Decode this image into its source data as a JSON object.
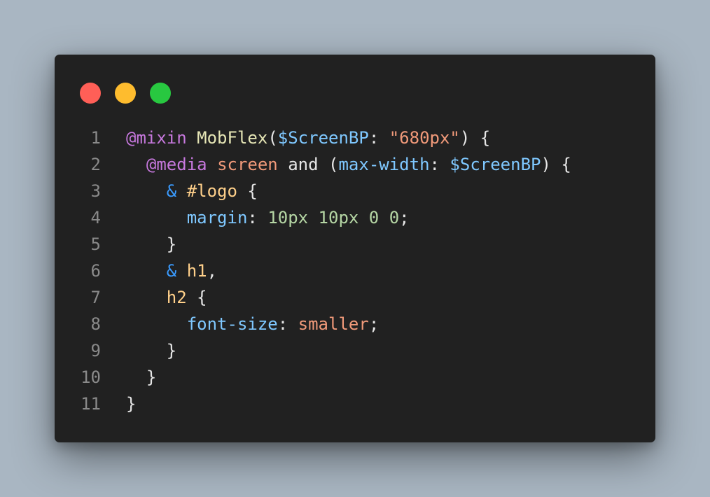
{
  "colors": {
    "background": "#a9b6c2",
    "window": "#212121",
    "dot_red": "#ff5f57",
    "dot_yellow": "#febc2e",
    "dot_green": "#28c840",
    "line_number": "#8a8a8a",
    "plain": "#e6e6e6"
  },
  "window_controls": [
    {
      "name": "close-dot",
      "color": "#ff5f57"
    },
    {
      "name": "minimize-dot",
      "color": "#febc2e"
    },
    {
      "name": "maximize-dot",
      "color": "#28c840"
    }
  ],
  "code_lines": [
    {
      "num": "1",
      "tokens": [
        {
          "t": "@mixin",
          "c": "#c678dd"
        },
        {
          "t": " ",
          "c": "#e6e6e6"
        },
        {
          "t": "MobFlex",
          "c": "#e5e5b5"
        },
        {
          "t": "(",
          "c": "#e6e6e6"
        },
        {
          "t": "$ScreenBP",
          "c": "#7fc8ff"
        },
        {
          "t": ": ",
          "c": "#e6e6e6"
        },
        {
          "t": "\"680px\"",
          "c": "#f19a7a"
        },
        {
          "t": ") {",
          "c": "#e6e6e6"
        }
      ]
    },
    {
      "num": "2",
      "tokens": [
        {
          "t": "  ",
          "c": "#e6e6e6"
        },
        {
          "t": "@media",
          "c": "#c678dd"
        },
        {
          "t": " ",
          "c": "#e6e6e6"
        },
        {
          "t": "screen",
          "c": "#f19a7a"
        },
        {
          "t": " and (",
          "c": "#e6e6e6"
        },
        {
          "t": "max-width",
          "c": "#7fc8ff"
        },
        {
          "t": ": ",
          "c": "#e6e6e6"
        },
        {
          "t": "$ScreenBP",
          "c": "#7fc8ff"
        },
        {
          "t": ") {",
          "c": "#e6e6e6"
        }
      ]
    },
    {
      "num": "3",
      "tokens": [
        {
          "t": "    ",
          "c": "#e6e6e6"
        },
        {
          "t": "&",
          "c": "#3a9bff"
        },
        {
          "t": " ",
          "c": "#e6e6e6"
        },
        {
          "t": "#logo",
          "c": "#ffd08a"
        },
        {
          "t": " {",
          "c": "#e6e6e6"
        }
      ]
    },
    {
      "num": "4",
      "tokens": [
        {
          "t": "      ",
          "c": "#e6e6e6"
        },
        {
          "t": "margin",
          "c": "#7fc8ff"
        },
        {
          "t": ": ",
          "c": "#e6e6e6"
        },
        {
          "t": "10px 10px 0 0",
          "c": "#b5d6a4"
        },
        {
          "t": ";",
          "c": "#e6e6e6"
        }
      ]
    },
    {
      "num": "5",
      "tokens": [
        {
          "t": "    }",
          "c": "#e6e6e6"
        }
      ]
    },
    {
      "num": "6",
      "tokens": [
        {
          "t": "    ",
          "c": "#e6e6e6"
        },
        {
          "t": "&",
          "c": "#3a9bff"
        },
        {
          "t": " ",
          "c": "#e6e6e6"
        },
        {
          "t": "h1",
          "c": "#ffd08a"
        },
        {
          "t": ",",
          "c": "#e6e6e6"
        }
      ]
    },
    {
      "num": "7",
      "tokens": [
        {
          "t": "    ",
          "c": "#e6e6e6"
        },
        {
          "t": "h2",
          "c": "#ffd08a"
        },
        {
          "t": " {",
          "c": "#e6e6e6"
        }
      ]
    },
    {
      "num": "8",
      "tokens": [
        {
          "t": "      ",
          "c": "#e6e6e6"
        },
        {
          "t": "font-size",
          "c": "#7fc8ff"
        },
        {
          "t": ": ",
          "c": "#e6e6e6"
        },
        {
          "t": "smaller",
          "c": "#f19a7a"
        },
        {
          "t": ";",
          "c": "#e6e6e6"
        }
      ]
    },
    {
      "num": "9",
      "tokens": [
        {
          "t": "    }",
          "c": "#e6e6e6"
        }
      ]
    },
    {
      "num": "10",
      "tokens": [
        {
          "t": "  }",
          "c": "#e6e6e6"
        }
      ]
    },
    {
      "num": "11",
      "tokens": [
        {
          "t": "}",
          "c": "#e6e6e6"
        }
      ]
    }
  ]
}
